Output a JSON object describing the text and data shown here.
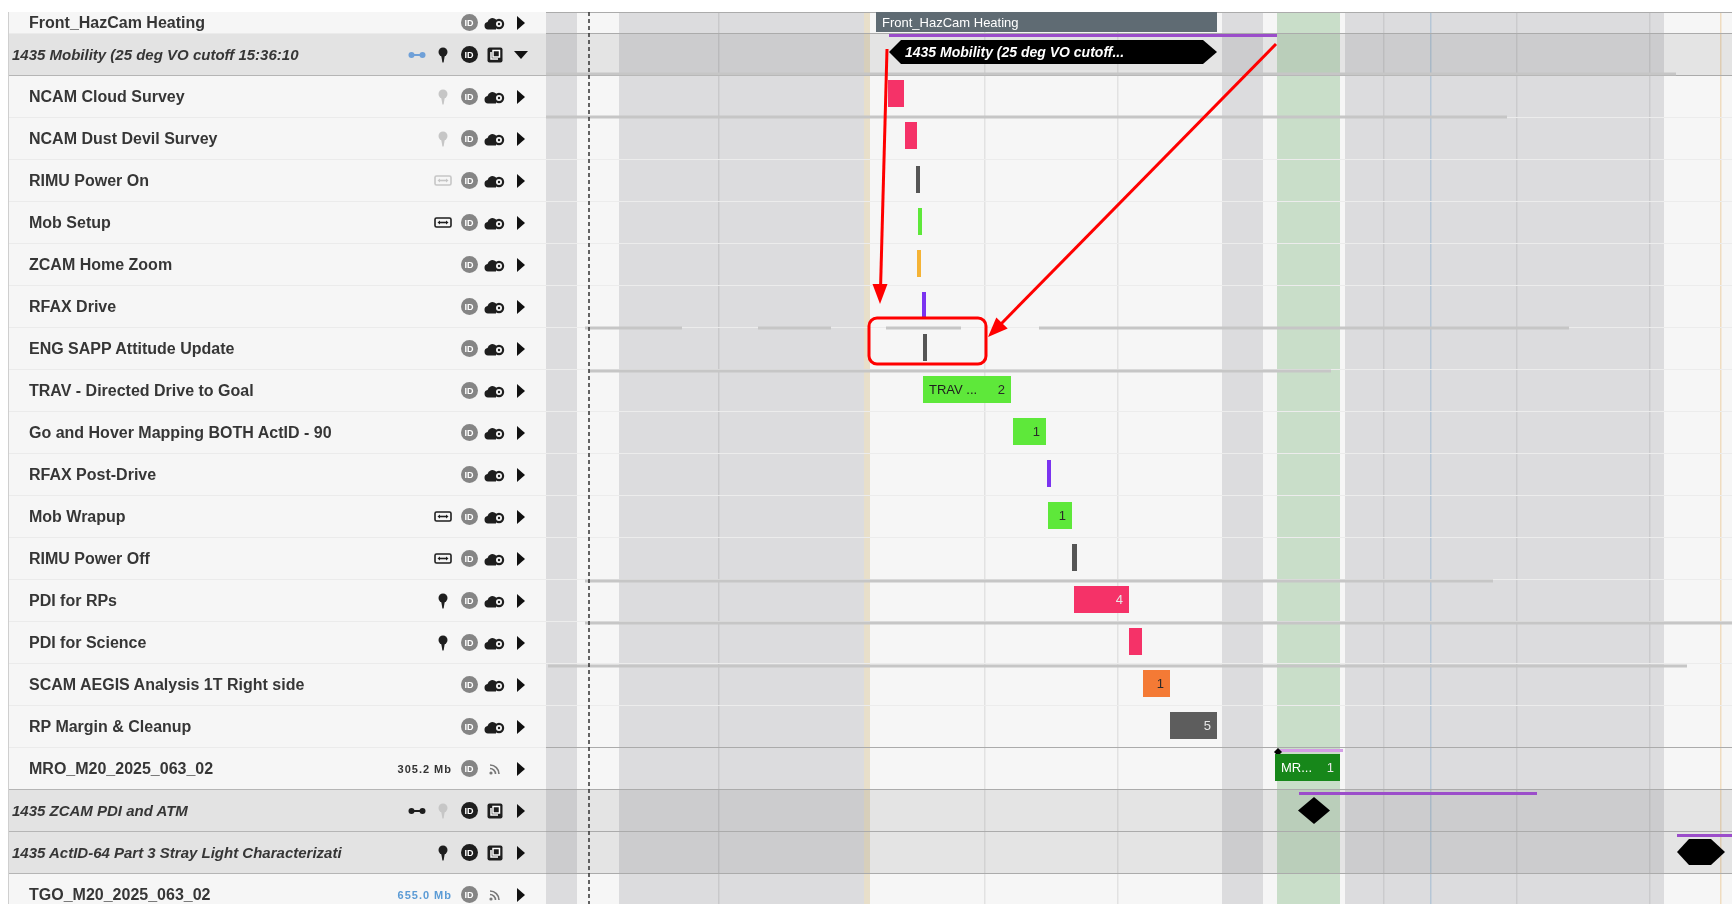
{
  "rows": [
    {
      "kind": "activity",
      "label": "Front_HazCam Heating",
      "id_label": "ID",
      "id_active": false,
      "bars": [
        {
          "kind": "bar",
          "color": "#5f6b73",
          "label": "Front_HazCam Heating"
        }
      ]
    },
    {
      "kind": "group",
      "label": "1435 Mobility (25 deg VO cutoff 15:36:10",
      "link_active": true,
      "pin_active": true,
      "id_label": "ID",
      "id_active": true,
      "expanded": true,
      "bars": [
        {
          "kind": "span",
          "color": "#9b4dca"
        },
        {
          "kind": "hexagon",
          "label": "1435 Mobility (25 deg VO cutoff..."
        }
      ]
    },
    {
      "kind": "activity",
      "label": "NCAM Cloud Survey",
      "pin_active": false,
      "id_label": "ID",
      "id_active": false,
      "bars": [
        {
          "kind": "bar",
          "color": "#f53268"
        }
      ]
    },
    {
      "kind": "activity",
      "label": "NCAM Dust Devil Survey",
      "pin_active": false,
      "id_label": "ID",
      "id_active": false,
      "bars": [
        {
          "kind": "bar",
          "color": "#f53268"
        }
      ]
    },
    {
      "kind": "activity",
      "label": "RIMU Power On",
      "drive_active": false,
      "id_label": "ID",
      "id_active": false,
      "bars": [
        {
          "kind": "tick",
          "color": "#555555"
        }
      ]
    },
    {
      "kind": "activity",
      "label": "Mob Setup",
      "drive_active": true,
      "id_label": "ID",
      "id_active": false,
      "bars": [
        {
          "kind": "tick",
          "color": "#5ee83a"
        }
      ]
    },
    {
      "kind": "activity",
      "label": "ZCAM Home Zoom",
      "id_label": "ID",
      "id_active": false,
      "bars": [
        {
          "kind": "tick",
          "color": "#f5b335"
        }
      ]
    },
    {
      "kind": "activity",
      "label": "RFAX Drive",
      "id_label": "ID",
      "id_active": false,
      "bars": [
        {
          "kind": "tick",
          "color": "#7b33f0"
        }
      ]
    },
    {
      "kind": "activity",
      "label": "ENG SAPP Attitude Update",
      "id_label": "ID",
      "id_active": false,
      "bars": [
        {
          "kind": "tick",
          "color": "#555555"
        }
      ]
    },
    {
      "kind": "activity",
      "label": "TRAV - Directed Drive to Goal",
      "id_label": "ID",
      "id_active": false,
      "bars": [
        {
          "kind": "bar",
          "color": "#5ee83a",
          "label": "TRAV ...",
          "count": "2"
        }
      ]
    },
    {
      "kind": "activity",
      "label": "Go and Hover Mapping BOTH ActID - 90",
      "id_label": "ID",
      "id_active": false,
      "bars": [
        {
          "kind": "bar",
          "color": "#5ee83a",
          "count": "1"
        }
      ]
    },
    {
      "kind": "activity",
      "label": "RFAX Post-Drive",
      "id_label": "ID",
      "id_active": false,
      "bars": [
        {
          "kind": "tick",
          "color": "#7b33f0"
        }
      ]
    },
    {
      "kind": "activity",
      "label": "Mob Wrapup",
      "drive_active": true,
      "id_label": "ID",
      "id_active": false,
      "bars": [
        {
          "kind": "bar",
          "color": "#5ee83a",
          "count": "1"
        }
      ]
    },
    {
      "kind": "activity",
      "label": "RIMU Power Off",
      "drive_active": true,
      "id_label": "ID",
      "id_active": false,
      "bars": [
        {
          "kind": "tick",
          "color": "#555555"
        }
      ]
    },
    {
      "kind": "activity",
      "label": "PDI for RPs",
      "pin_active": true,
      "id_label": "ID",
      "id_active": false,
      "bars": [
        {
          "kind": "bar",
          "color": "#f53268",
          "count": "4"
        }
      ]
    },
    {
      "kind": "activity",
      "label": "PDI for Science",
      "pin_active": true,
      "id_label": "ID",
      "id_active": false,
      "bars": [
        {
          "kind": "bar",
          "color": "#f53268"
        }
      ]
    },
    {
      "kind": "activity",
      "label": "SCAM AEGIS Analysis 1T Right side",
      "id_label": "ID",
      "id_active": false,
      "bars": [
        {
          "kind": "bar",
          "color": "#f47a35",
          "count": "1"
        }
      ]
    },
    {
      "kind": "activity",
      "label": "RP Margin & Cleanup",
      "id_label": "ID",
      "id_active": false,
      "bars": [
        {
          "kind": "bar",
          "color": "#5d5d5d",
          "count": "5"
        }
      ]
    },
    {
      "kind": "pass",
      "label": "MRO_M20_2025_063_02",
      "size": "305.2 Mb",
      "size_highlight": false,
      "id_label": "ID",
      "id_active": false,
      "bars": [
        {
          "kind": "span",
          "color": "#d49ee6"
        },
        {
          "kind": "marker"
        },
        {
          "kind": "bar",
          "color": "#17871a",
          "label": "MR...",
          "count": "1"
        }
      ]
    },
    {
      "kind": "group",
      "label": "1435 ZCAM PDI and ATM",
      "link_active": false,
      "pin_active": false,
      "id_label": "ID",
      "id_active": true,
      "expanded": false,
      "bars": [
        {
          "kind": "span",
          "color": "#9b4dca"
        },
        {
          "kind": "diamond"
        }
      ]
    },
    {
      "kind": "group",
      "label": "1435 ActID-64 Part 3 Stray Light Characterizati",
      "pin_active": true,
      "id_label": "ID",
      "id_active": true,
      "expanded": false,
      "bars": [
        {
          "kind": "span",
          "color": "#9b4dca"
        },
        {
          "kind": "hexagon"
        }
      ]
    },
    {
      "kind": "pass",
      "label": "TGO_M20_2025_063_02",
      "size": "655.0 Mb",
      "size_highlight": true,
      "id_label": "ID",
      "id_active": false,
      "bars": []
    }
  ]
}
